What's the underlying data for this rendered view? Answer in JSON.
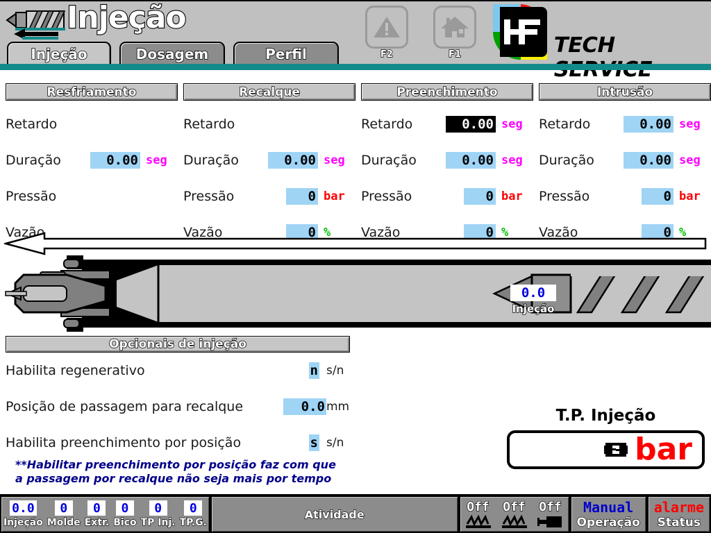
{
  "header": {
    "page_title": "Injeção",
    "screw_icon": "screw-icon",
    "back_arrow_icon": "back-arrow-icon",
    "tabs": [
      {
        "label": "Injeção",
        "active": true
      },
      {
        "label": "Dosagem",
        "active": false
      },
      {
        "label": "Perfil",
        "active": false
      }
    ],
    "fkeys": [
      {
        "label": "F2",
        "icon": "warning-triangle-icon"
      },
      {
        "label": "F1",
        "icon": "home-icon"
      }
    ],
    "brand": {
      "mark_text": "HF",
      "text": "TECH SERVICE",
      "colors": {
        "top_left": "#7ec8ef",
        "top_right": "#ee1111",
        "bottom_left": "#00a000",
        "bottom_right": "#ffee00"
      }
    },
    "accent_color": "#138a8a"
  },
  "panels": [
    {
      "title": "Resfriamento",
      "rows": [
        {
          "label": "Retardo",
          "value": "",
          "unit": "",
          "unit_kind": "seg",
          "has_field": false,
          "focused": false,
          "width": "wide"
        },
        {
          "label": "Duração",
          "value": "0.00",
          "unit": "seg",
          "unit_kind": "seg",
          "has_field": true,
          "focused": false,
          "width": "wide"
        },
        {
          "label": "Pressão",
          "value": "",
          "unit": "",
          "unit_kind": "bar",
          "has_field": false,
          "focused": false,
          "width": "narrow"
        },
        {
          "label": "Vazão",
          "value": "",
          "unit": "",
          "unit_kind": "pct",
          "has_field": false,
          "focused": false,
          "width": "narrow"
        }
      ]
    },
    {
      "title": "Recalque",
      "rows": [
        {
          "label": "Retardo",
          "value": "",
          "unit": "",
          "unit_kind": "seg",
          "has_field": false,
          "focused": false,
          "width": "wide"
        },
        {
          "label": "Duração",
          "value": "0.00",
          "unit": "seg",
          "unit_kind": "seg",
          "has_field": true,
          "focused": false,
          "width": "wide"
        },
        {
          "label": "Pressão",
          "value": "0",
          "unit": "bar",
          "unit_kind": "bar",
          "has_field": true,
          "focused": false,
          "width": "narrow"
        },
        {
          "label": "Vazão",
          "value": "0",
          "unit": "%",
          "unit_kind": "pct",
          "has_field": true,
          "focused": false,
          "width": "narrow"
        }
      ]
    },
    {
      "title": "Preenchimento",
      "rows": [
        {
          "label": "Retardo",
          "value": "0.00",
          "unit": "seg",
          "unit_kind": "seg",
          "has_field": true,
          "focused": true,
          "width": "wide"
        },
        {
          "label": "Duração",
          "value": "0.00",
          "unit": "seg",
          "unit_kind": "seg",
          "has_field": true,
          "focused": false,
          "width": "wide"
        },
        {
          "label": "Pressão",
          "value": "0",
          "unit": "bar",
          "unit_kind": "bar",
          "has_field": true,
          "focused": false,
          "width": "narrow"
        },
        {
          "label": "Vazão",
          "value": "0",
          "unit": "%",
          "unit_kind": "pct",
          "has_field": true,
          "focused": false,
          "width": "narrow"
        }
      ]
    },
    {
      "title": "Intrusão",
      "rows": [
        {
          "label": "Retardo",
          "value": "0.00",
          "unit": "seg",
          "unit_kind": "seg",
          "has_field": true,
          "focused": false,
          "width": "wide"
        },
        {
          "label": "Duração",
          "value": "0.00",
          "unit": "seg",
          "unit_kind": "seg",
          "has_field": true,
          "focused": false,
          "width": "wide"
        },
        {
          "label": "Pressão",
          "value": "0",
          "unit": "bar",
          "unit_kind": "bar",
          "has_field": true,
          "focused": false,
          "width": "narrow"
        },
        {
          "label": "Vazão",
          "value": "0",
          "unit": "%",
          "unit_kind": "pct",
          "has_field": true,
          "focused": false,
          "width": "narrow"
        }
      ]
    }
  ],
  "machine": {
    "direction_arrow_icon": "left-arrow-icon",
    "injection_value": "0.0",
    "injection_label": "Injeção"
  },
  "options": {
    "title": "Opcionais de injeção",
    "rows": [
      {
        "label": "Habilita regenerativo",
        "value": "n",
        "unit": "s/n",
        "kind": "toggle"
      },
      {
        "label": "Posição de passagem para recalque",
        "value": "0.0",
        "unit": "mm",
        "kind": "num"
      },
      {
        "label": "Habilita preenchimento por posição",
        "value": "s",
        "unit": "s/n",
        "kind": "toggle"
      }
    ],
    "note_line1": "**Habilitar preenchimento por posição faz com que",
    "note_line2": "a passagem por recalque não seja mais por tempo"
  },
  "tp": {
    "title": "T.P. Injeção",
    "value_glyph": "invalid-value-icon",
    "unit": "bar"
  },
  "statusbar": {
    "numbers": [
      {
        "value": "0.0",
        "caption": "Injeção"
      },
      {
        "value": "0",
        "caption": "Molde"
      },
      {
        "value": "0",
        "caption": "Extr."
      },
      {
        "value": "0",
        "caption": "Bico"
      },
      {
        "value": "0",
        "caption": "TP Inj."
      },
      {
        "value": "0",
        "caption": "TP.G."
      }
    ],
    "activity": "Atividade",
    "outputs": [
      {
        "state": "Off",
        "icon": "heater-coil-icon"
      },
      {
        "state": "Off",
        "icon": "heater-coil-icon"
      },
      {
        "state": "Off",
        "icon": "motor-icon"
      }
    ],
    "mode_value": "Manual",
    "mode_label": "Operação",
    "alarm_value": "alarme",
    "alarm_label": "Status"
  }
}
